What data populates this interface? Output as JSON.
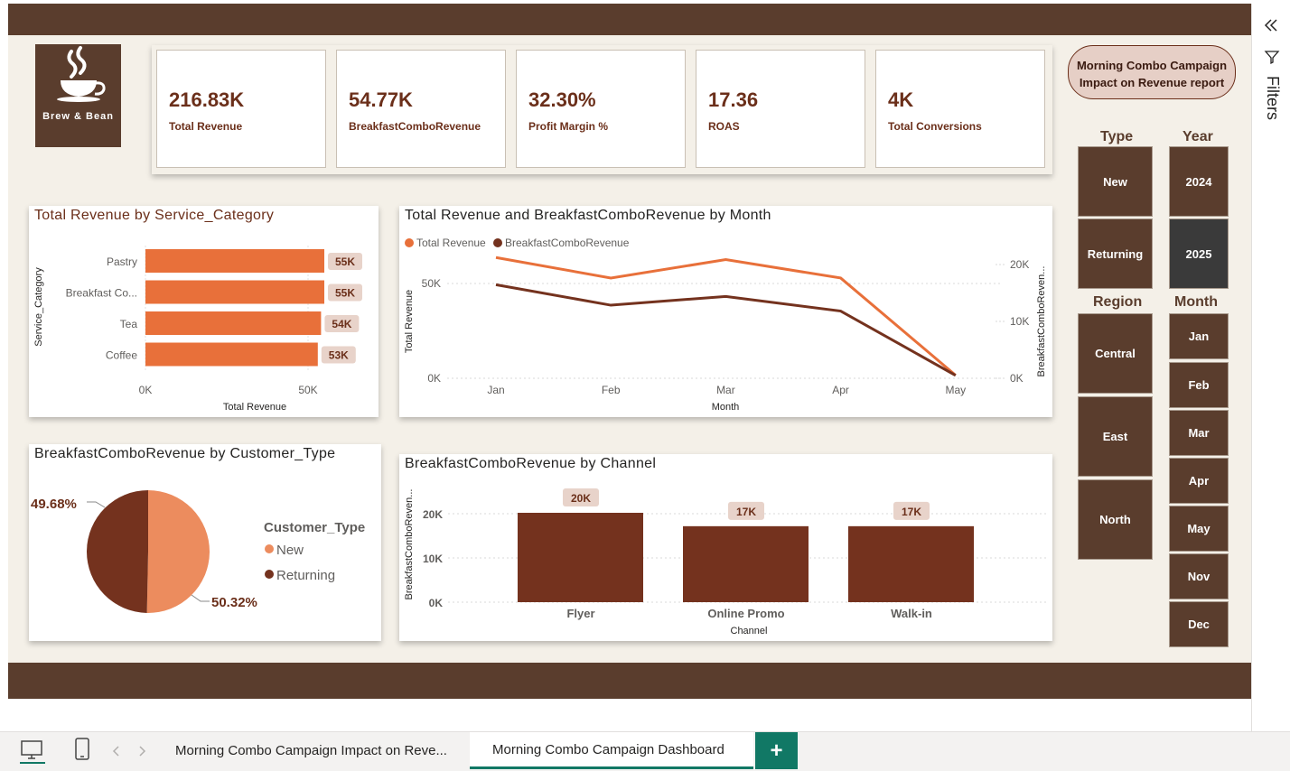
{
  "logo": {
    "text": "Brew & Bean"
  },
  "report_title": {
    "line1": "Morning Combo Campaign",
    "line2": "Impact on Revenue report"
  },
  "kpis": [
    {
      "value": "216.83K",
      "label": "Total Revenue"
    },
    {
      "value": "54.77K",
      "label": "BreakfastComboRevenue"
    },
    {
      "value": "32.30%",
      "label": "Profit Margin %"
    },
    {
      "value": "17.36",
      "label": "ROAS"
    },
    {
      "value": "4K",
      "label": "Total Conversions"
    }
  ],
  "chart_service": {
    "title": "Total Revenue by Service_Category",
    "xlabel": "Total Revenue",
    "ylabel": "Service_Category",
    "xticks": [
      "0K",
      "50K"
    ],
    "data_labels": [
      "55K",
      "55K",
      "54K",
      "53K"
    ]
  },
  "chart_month": {
    "title": "Total Revenue and BreakfastComboRevenue by Month",
    "legend": [
      "Total Revenue",
      "BreakfastComboRevenue"
    ],
    "xlabel": "Month",
    "ylabel_left": "Total Revenue",
    "ylabel_right": "BreakfastComboReven...",
    "yticks_left": [
      "0K",
      "50K"
    ],
    "yticks_right": [
      "0K",
      "10K",
      "20K"
    ]
  },
  "chart_customer": {
    "title": "BreakfastComboRevenue by Customer_Type",
    "legend_title": "Customer_Type",
    "legend": [
      "New",
      "Returning"
    ],
    "labels": [
      "50.32%",
      "49.68%"
    ]
  },
  "chart_channel": {
    "title": "BreakfastComboRevenue by Channel",
    "xlabel": "Channel",
    "ylabel": "BreakfastComboReven...",
    "yticks": [
      "0K",
      "10K",
      "20K"
    ],
    "data_labels": [
      "20K",
      "17K",
      "17K"
    ]
  },
  "slicers": {
    "type": {
      "label": "Type",
      "options": [
        "New",
        "Returning"
      ]
    },
    "year": {
      "label": "Year",
      "options": [
        "2024",
        "2025"
      ],
      "selected": "2025"
    },
    "region": {
      "label": "Region",
      "options": [
        "Central",
        "East",
        "North"
      ]
    },
    "month": {
      "label": "Month",
      "options": [
        "Jan",
        "Feb",
        "Mar",
        "Apr",
        "May",
        "Nov",
        "Dec"
      ]
    }
  },
  "filters_pane": {
    "label": "Filters"
  },
  "tabs": [
    {
      "label": "Morning Combo Campaign Impact on Reve..."
    },
    {
      "label": "Morning Combo Campaign Dashboard",
      "active": true
    }
  ],
  "add_tab": "+",
  "colors": {
    "brown": "#5a3d2d",
    "orange": "#e8703a",
    "dark_red": "#74321e",
    "light_orange": "#ec8c5e"
  },
  "chart_data": [
    {
      "type": "bar",
      "title": "Total Revenue by Service_Category",
      "categories": [
        "Pastry",
        "Breakfast Co...",
        "Tea",
        "Coffee"
      ],
      "values": [
        55000,
        55000,
        54000,
        53000
      ],
      "xlabel": "Total Revenue",
      "ylabel": "Service_Category",
      "xlim": [
        0,
        60000
      ]
    },
    {
      "type": "line",
      "title": "Total Revenue and BreakfastComboRevenue by Month",
      "x": [
        "Jan",
        "Feb",
        "Mar",
        "Apr",
        "May"
      ],
      "series": [
        {
          "name": "Total Revenue",
          "values": [
            59000,
            49000,
            58000,
            49000,
            1500
          ],
          "axis": "left"
        },
        {
          "name": "BreakfastComboRevenue",
          "values": [
            16000,
            12500,
            14000,
            11500,
            500
          ],
          "axis": "right"
        }
      ],
      "ylim_left": [
        0,
        60000
      ],
      "ylim_right": [
        0,
        21000
      ]
    },
    {
      "type": "pie",
      "title": "BreakfastComboRevenue by Customer_Type",
      "categories": [
        "New",
        "Returning"
      ],
      "values": [
        50.32,
        49.68
      ]
    },
    {
      "type": "bar",
      "title": "BreakfastComboRevenue by Channel",
      "categories": [
        "Flyer",
        "Online Promo",
        "Walk-in"
      ],
      "values": [
        20000,
        17000,
        17000
      ],
      "xlabel": "Channel",
      "ylabel": "BreakfastComboReven...",
      "ylim": [
        0,
        23000
      ]
    }
  ]
}
